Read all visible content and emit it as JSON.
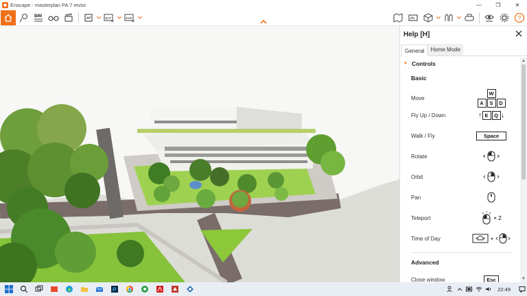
{
  "window": {
    "title": "Enscape - masterplan PA 7 revisi",
    "minimize": "—",
    "maximize": "❐",
    "close": "✕"
  },
  "toolbar": {
    "bim_label": "BIM",
    "batch_label": "BAT",
    "exe_label": "EXE"
  },
  "help": {
    "title": "Help [H]",
    "tabs": [
      {
        "label": "General"
      },
      {
        "label": "Home Mode"
      }
    ],
    "controls_heading": "Controls",
    "basic_heading": "Basic",
    "advanced_heading": "Advanced",
    "rows": [
      {
        "label": "Move",
        "keys_top": "W",
        "keys": [
          "A",
          "S",
          "D"
        ]
      },
      {
        "label": "Fly Up / Down",
        "keys": [
          "E",
          "Q"
        ]
      },
      {
        "label": "Walk / Fly",
        "keys": [
          "Space"
        ]
      },
      {
        "label": "Rotate"
      },
      {
        "label": "Orbit"
      },
      {
        "label": "Pan"
      },
      {
        "label": "Teleport",
        "suffix": "× 2"
      },
      {
        "label": "Time of Day",
        "joiner": "+"
      }
    ],
    "advanced_rows": [
      {
        "label": "Close window",
        "keys": [
          "Esc"
        ]
      }
    ]
  },
  "taskbar": {
    "time": "22:49"
  },
  "colors": {
    "accent": "#f0701a",
    "taskbar": "#e9eef5"
  }
}
